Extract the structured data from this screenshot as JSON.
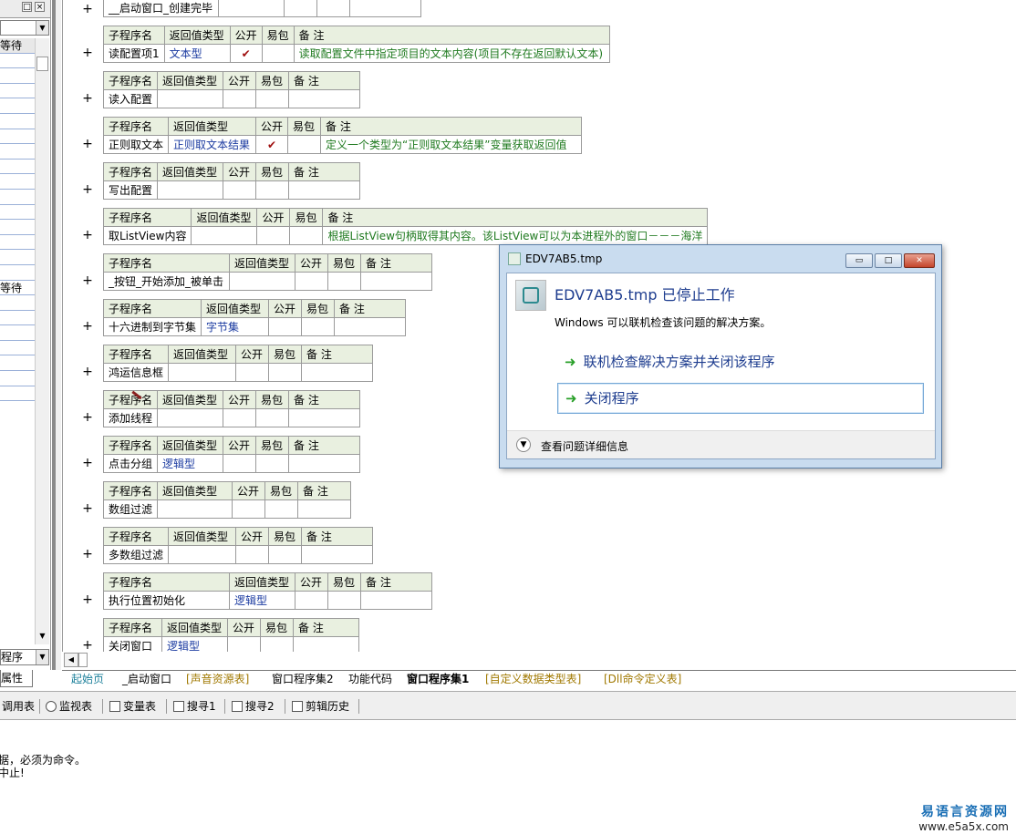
{
  "left_panel": {
    "combo_value": "",
    "rows": [
      "等待",
      "",
      "",
      "",
      "",
      "",
      "",
      "",
      "",
      "",
      "",
      "",
      "",
      "",
      "",
      "",
      "等待",
      "",
      "",
      "",
      "",
      "",
      "",
      ""
    ],
    "bottom_combo": "程序",
    "tab_label": "属性"
  },
  "table_headers": {
    "name": "子程序名",
    "return_type": "返回值类型",
    "public": "公开",
    "easy_pack": "易包",
    "remark": "备 注"
  },
  "first_row_name": "__启动窗口_创建完毕",
  "subroutines": [
    {
      "name": "读配置项1",
      "return_type": "文本型",
      "public": "✔",
      "remark": "读取配置文件中指定项目的文本内容(项目不存在返回默认文本)"
    },
    {
      "name": "读入配置",
      "return_type": "",
      "public": "",
      "remark": ""
    },
    {
      "name": "正则取文本",
      "return_type": "正则取文本结果",
      "public": "✔",
      "remark": "定义一个类型为“正则取文本结果”变量获取返回值"
    },
    {
      "name": "写出配置",
      "return_type": "",
      "public": "",
      "remark": ""
    },
    {
      "name": "取ListView内容",
      "return_type": "",
      "public": "",
      "remark": "根据ListView句柄取得其内容。该ListView可以为本进程外的窗口－－－海洋"
    },
    {
      "name": "_按钮_开始添加_被单击",
      "return_type": "",
      "public": "",
      "remark": ""
    },
    {
      "name": "十六进制到字节集",
      "return_type": "字节集",
      "public": "",
      "remark": ""
    },
    {
      "name": "鸿运信息框",
      "return_type": "",
      "public": "",
      "remark": ""
    },
    {
      "name": "添加线程",
      "return_type": "",
      "public": "",
      "remark": ""
    },
    {
      "name": "点击分组",
      "return_type": "逻辑型",
      "public": "",
      "remark": ""
    },
    {
      "name": "数组过滤",
      "return_type": "",
      "public": "",
      "remark": ""
    },
    {
      "name": "多数组过滤",
      "return_type": "",
      "public": "",
      "remark": ""
    },
    {
      "name": "执行位置初始化",
      "return_type": "逻辑型",
      "public": "",
      "remark": ""
    },
    {
      "name": "关闭窗口",
      "return_type": "逻辑型",
      "public": "",
      "remark": ""
    }
  ],
  "tabs": [
    {
      "label": "起始页"
    },
    {
      "label": "_启动窗口"
    },
    {
      "label": "[声音资源表]"
    },
    {
      "label": "窗口程序集2"
    },
    {
      "label": "功能代码"
    },
    {
      "label": "窗口程序集1"
    },
    {
      "label": "[自定义数据类型表]"
    },
    {
      "label": "[Dll命令定义表]"
    }
  ],
  "toolbar": {
    "call_table": "调用表",
    "watch": "监视表",
    "variables": "变量表",
    "search1": "搜寻1",
    "search2": "搜寻2",
    "clip_history": "剪辑历史"
  },
  "output": {
    "line1": "据，必须为命令。",
    "line2": "中止!"
  },
  "watermark": {
    "name": "易语言资源网",
    "url": "www.e5a5x.com"
  },
  "dialog": {
    "title": "EDV7AB5.tmp",
    "heading": "EDV7AB5.tmp 已停止工作",
    "description": "Windows 可以联机检查该问题的解决方案。",
    "option1": "联机检查解决方案并关闭该程序",
    "option2": "关闭程序",
    "details": "查看问题详细信息",
    "min_glyph": "▭",
    "max_glyph": "□",
    "close_glyph": "✕"
  }
}
